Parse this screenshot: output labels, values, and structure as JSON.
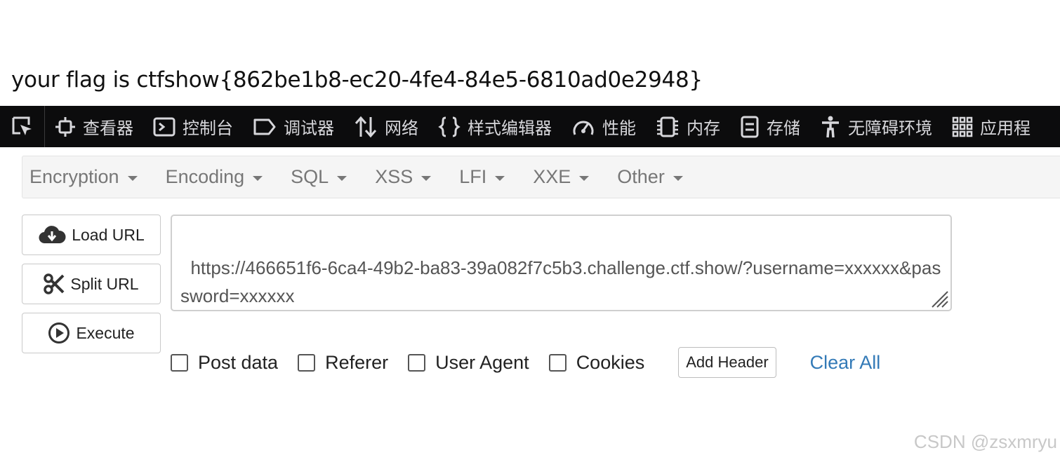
{
  "page": {
    "flag_text": "your flag is ctfshow{862be1b8-ec20-4fe4-84e5-6810ad0e2948}"
  },
  "devtools": {
    "tabs": [
      {
        "label": "查看器",
        "icon": "inspector-icon"
      },
      {
        "label": "控制台",
        "icon": "console-icon"
      },
      {
        "label": "调试器",
        "icon": "debugger-icon"
      },
      {
        "label": "网络",
        "icon": "network-icon"
      },
      {
        "label": "样式编辑器",
        "icon": "style-editor-icon"
      },
      {
        "label": "性能",
        "icon": "performance-icon"
      },
      {
        "label": "内存",
        "icon": "memory-icon"
      },
      {
        "label": "存储",
        "icon": "storage-icon"
      },
      {
        "label": "无障碍环境",
        "icon": "accessibility-icon"
      },
      {
        "label": "应用程",
        "icon": "application-icon"
      }
    ]
  },
  "hackbar": {
    "menu": [
      "Encryption",
      "Encoding",
      "SQL",
      "XSS",
      "LFI",
      "XXE",
      "Other"
    ],
    "buttons": {
      "load_url": "Load URL",
      "split_url": "Split URL",
      "execute": "Execute"
    },
    "url_value": "https://466651f6-6ca4-49b2-ba83-39a082f7c5b3.challenge.ctf.show/?username=xxxxxx&password=xxxxxx",
    "options": {
      "post_data": "Post data",
      "referer": "Referer",
      "user_agent": "User Agent",
      "cookies": "Cookies"
    },
    "add_header": "Add Header",
    "clear_all": "Clear All"
  },
  "watermark": "CSDN @zsxmryu",
  "colors": {
    "devtools_bg": "#0c0c0d",
    "devtools_text": "#d7d7db",
    "link_blue": "#337ab7",
    "menu_bg": "#f5f5f5"
  }
}
